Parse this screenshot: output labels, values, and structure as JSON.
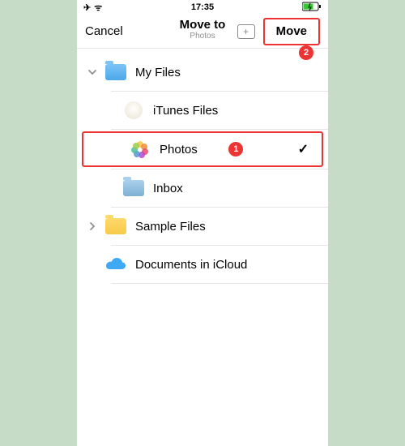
{
  "status": {
    "time": "17:35",
    "airplane": "✈",
    "wifi": "ᯤ",
    "battery": "🔋"
  },
  "nav": {
    "cancel": "Cancel",
    "title": "Move to",
    "subtitle": "Photos",
    "move": "Move"
  },
  "rows": {
    "myfiles": "My Files",
    "itunes": "iTunes Files",
    "photos": "Photos",
    "inbox": "Inbox",
    "sample": "Sample Files",
    "icloud": "Documents in iCloud"
  },
  "annotations": {
    "badge1": "1",
    "badge2": "2"
  }
}
